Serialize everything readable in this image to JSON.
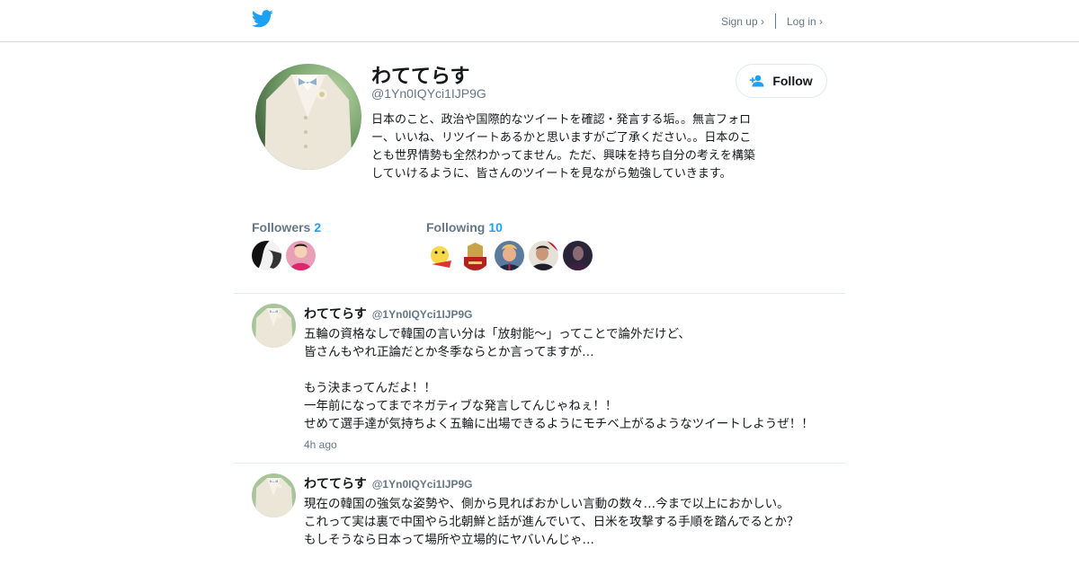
{
  "header": {
    "logo_icon": "twitter-bird-icon",
    "signup_label": "Sign up ›",
    "login_label": "Log in ›",
    "brand_color": "#1da1f2"
  },
  "profile": {
    "name": "わててらす",
    "handle": "@1Yn0IQYci1IJP9G",
    "bio": "日本のこと、政治や国際的なツイートを確認・発言する垢。。無言フォロー、いいね、リツイートあるかと思いますがご了承ください。。日本のことも世界情勢も全然わかってません。ただ、興味を持ち自分の考えを構築していけるように、皆さんのツイートを見ながら勉強していきます。",
    "follow_label": "Follow",
    "followers_label": "Followers",
    "followers_count": "2",
    "following_label": "Following",
    "following_count": "10"
  },
  "tweets": [
    {
      "name": "わててらす",
      "handle": "@1Yn0IQYci1IJP9G",
      "text": "五輪の資格なしで韓国の言い分は「放射能〜」ってことで論外だけど、\n皆さんもやれ正論だとか冬季ならとか言ってますが…\n\nもう決まってんだよ！！\n一年前になってまでネガティブな発言してんじゃねぇ！！\nせめて選手達が気持ちよく五輪に出場できるようにモチベ上がるようなツイートしようぜ！！",
      "time": "4h ago"
    },
    {
      "name": "わててらす",
      "handle": "@1Yn0IQYci1IJP9G",
      "text": "現在の韓国の強気な姿勢や、側から見ればおかしい言動の数々…今まで以上におかしい。\nこれって実は裏で中国やら北朝鮮と話が進んでいて、日米を攻撃する手順を踏んでるとか？\nもしそうなら日本って場所や立場的にヤバいんじゃ…"
    }
  ]
}
